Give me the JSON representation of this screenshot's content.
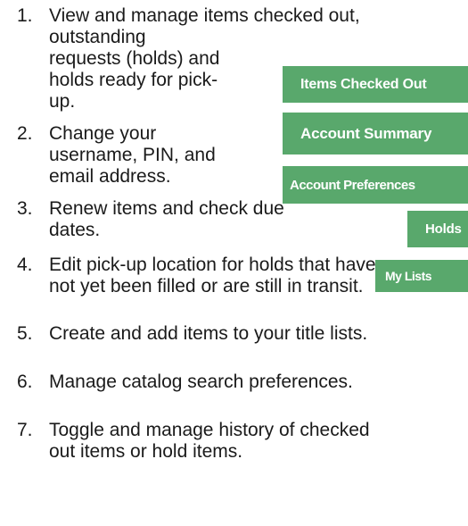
{
  "list": {
    "items": [
      {
        "num": "1.",
        "lines": [
          "View and manage items checked out,",
          "outstanding",
          "requests (holds) and",
          "holds ready for pick-",
          "up."
        ]
      },
      {
        "num": "2.",
        "lines": [
          "Change your",
          "username, PIN, and",
          "email address."
        ]
      },
      {
        "num": "3.",
        "lines": [
          "Renew items and check due",
          "dates."
        ]
      },
      {
        "num": "4.",
        "lines": [
          "Edit pick-up location for holds that have",
          "not yet been filled or are still in transit."
        ]
      },
      {
        "num": "5.",
        "lines": [
          "Create and add items to your title lists."
        ]
      },
      {
        "num": "6.",
        "lines": [
          "Manage catalog search preferences."
        ]
      },
      {
        "num": "7.",
        "lines": [
          "Toggle and manage history of checked",
          "out items or hold items."
        ]
      }
    ]
  },
  "buttons": {
    "items_checked_out": "Items Checked Out",
    "account_summary": "Account Summary",
    "account_preferences": "Account Preferences",
    "holds": "Holds",
    "my_lists": "My Lists"
  },
  "colors": {
    "button_green": "#59a86c",
    "button_text": "#ffffff",
    "body_text": "#1a1a1a"
  }
}
